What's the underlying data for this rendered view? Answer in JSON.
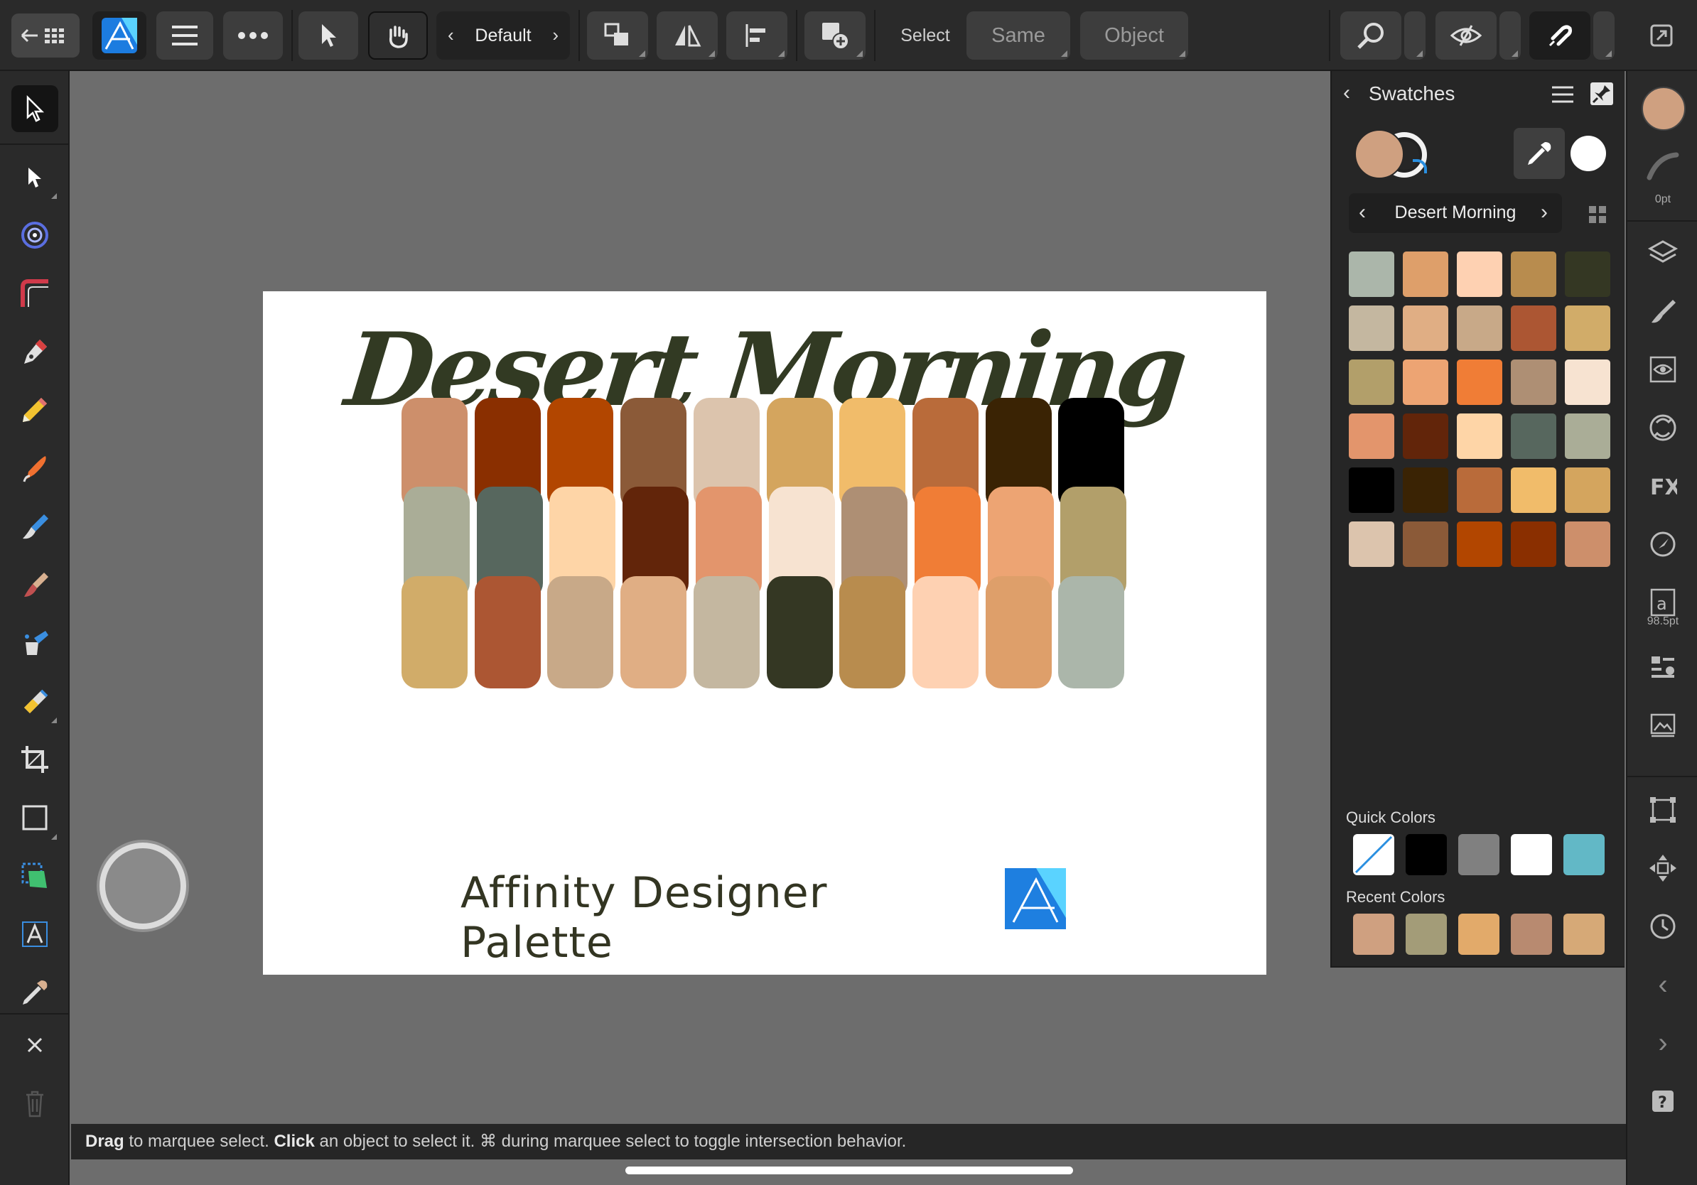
{
  "toolbar": {
    "persona_name": "Default",
    "select_label": "Select",
    "same_label": "Same",
    "object_label": "Object"
  },
  "artboard": {
    "title": "Desert Morning",
    "subtitle": "Affinity Designer Palette",
    "rows": [
      [
        "#CD8F6B",
        "#8A2F00",
        "#B24600",
        "#8B5A38",
        "#DCC4AD",
        "#D4A55E",
        "#F1BC6A",
        "#B96B3A",
        "#3A2304",
        "#000000"
      ],
      [
        "#AAAD97",
        "#57675E",
        "#FED5A7",
        "#62250A",
        "#E3956C",
        "#F7E3D1",
        "#AE8F74",
        "#F07D36",
        "#EDA473",
        "#B29F6A"
      ],
      [
        "#D1AC69",
        "#AC5633",
        "#C8A988",
        "#E0AE84",
        "#C4B7A0",
        "#343723",
        "#B88C4E",
        "#FED1B2",
        "#DE9F6A",
        "#ABB6AA"
      ]
    ]
  },
  "panel": {
    "title": "Swatches",
    "palette_name": "Desert Morning",
    "fill_color": "#CFA080",
    "stroke_color": "#FFFFFF",
    "grid": [
      [
        "#ABB6AA",
        "#DE9F6A",
        "#FED1B2",
        "#B88C4E",
        "#343723"
      ],
      [
        "#C4B7A0",
        "#E0AE84",
        "#C8A988",
        "#AC5633",
        "#D1AC69"
      ],
      [
        "#B29F6A",
        "#EDA473",
        "#F07D36",
        "#AE8F74",
        "#F7E3D1"
      ],
      [
        "#E3956C",
        "#62250A",
        "#FED5A7",
        "#57675E",
        "#AAAD97"
      ],
      [
        "#000000",
        "#3A2304",
        "#B96B3A",
        "#F1BC6A",
        "#D4A55E"
      ],
      [
        "#DCC4AD",
        "#8B5A38",
        "#B24600",
        "#8A2F00",
        "#CD8F6B"
      ]
    ],
    "quick_colors_label": "Quick Colors",
    "quick_colors": [
      "none",
      "#000000",
      "#808080",
      "#FFFFFF",
      "#62B8C6"
    ],
    "recent_colors_label": "Recent Colors",
    "recent_colors": [
      "#CFA080",
      "#A39C78",
      "#E2AA6A",
      "#B88A70",
      "#D6A977"
    ]
  },
  "studio": {
    "stroke_width": "0pt",
    "font_size": "98.5pt"
  },
  "status": {
    "part1_bold": "Drag",
    "part1": " to marquee select. ",
    "part2_bold": "Click",
    "part2": " an object to select it. ⌘ during marquee select to toggle intersection behavior."
  }
}
